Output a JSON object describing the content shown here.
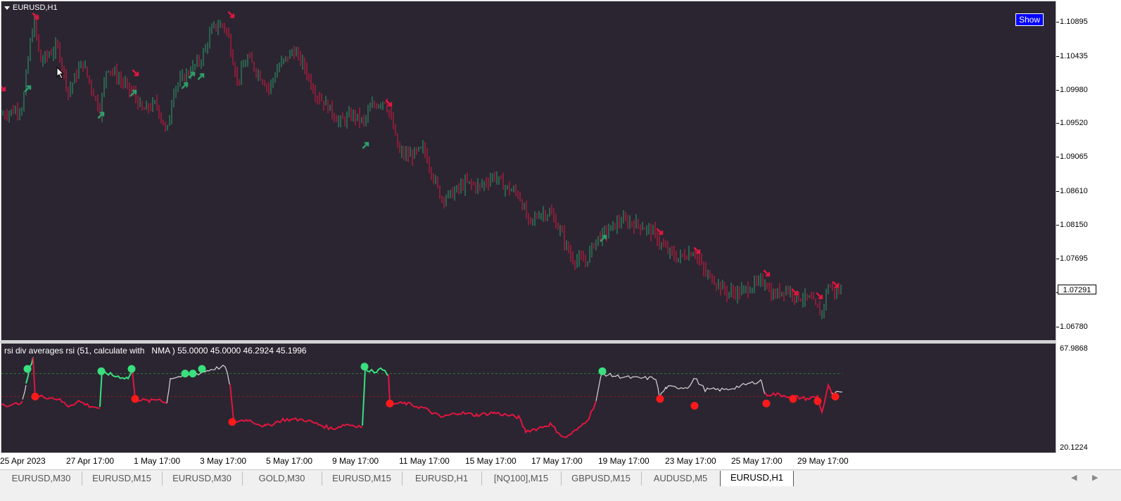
{
  "window": {
    "symbol": "EURUSD,H1",
    "show_button": "Show",
    "current_price": "1.07291"
  },
  "price_axis": [
    "1.10895",
    "1.10435",
    "1.09980",
    "1.09520",
    "1.09065",
    "1.08610",
    "1.08150",
    "1.07695",
    "1.07235",
    "1.06780"
  ],
  "indicator": {
    "title": "rsi div averages rsi (51, calculate with   NMA ) 55.0000 45.0000 46.2924 45.1996",
    "axis_max": "67.9868",
    "axis_min": "20.1224"
  },
  "time_axis": [
    "25 Apr 2023",
    "27 Apr 17:00",
    "1 May 17:00",
    "3 May 17:00",
    "5 May 17:00",
    "9 May 17:00",
    "11 May 17:00",
    "15 May 17:00",
    "17 May 17:00",
    "19 May 17:00",
    "23 May 17:00",
    "25 May 17:00",
    "29 May 17:00"
  ],
  "tabs": [
    {
      "label": "EURUSD,M30"
    },
    {
      "label": "EURUSD,M15"
    },
    {
      "label": "EURUSD,M30"
    },
    {
      "label": "GOLD,M30"
    },
    {
      "label": "EURUSD,M15"
    },
    {
      "label": "EURUSD,H1"
    },
    {
      "label": "[NQ100],M15"
    },
    {
      "label": "GBPUSD,M15"
    },
    {
      "label": "AUDUSD,M5"
    },
    {
      "label": "EURUSD,H1"
    }
  ],
  "active_tab": 9,
  "colors": {
    "background": "#2a2531",
    "bull": "#2e9e6a",
    "bear": "#e0163f",
    "rsi_green": "#39e07d",
    "rsi_red": "#e0163f",
    "rsi_white": "#d8d8d8",
    "show_button": "#0000ff"
  },
  "chart_data": {
    "type": "candlestick",
    "symbol": "EURUSD,H1",
    "ylim": [
      1.0665,
      1.1115
    ],
    "price_path": [
      [
        0,
        1.0965
      ],
      [
        30,
        1.0975
      ],
      [
        40,
        1.1055
      ],
      [
        47,
        1.109
      ],
      [
        55,
        1.1035
      ],
      [
        80,
        1.1055
      ],
      [
        95,
        1.0995
      ],
      [
        115,
        1.1035
      ],
      [
        140,
        1.097
      ],
      [
        150,
        1.103
      ],
      [
        175,
        1.1005
      ],
      [
        190,
        1.099
      ],
      [
        200,
        1.097
      ],
      [
        220,
        1.098
      ],
      [
        235,
        1.094
      ],
      [
        245,
        1.1
      ],
      [
        265,
        1.102
      ],
      [
        285,
        1.104
      ],
      [
        300,
        1.108
      ],
      [
        315,
        1.1085
      ],
      [
        322,
        1.107
      ],
      [
        335,
        1.101
      ],
      [
        350,
        1.104
      ],
      [
        365,
        1.102
      ],
      [
        380,
        1.1
      ],
      [
        395,
        1.103
      ],
      [
        415,
        1.105
      ],
      [
        430,
        1.103
      ],
      [
        445,
        1.0995
      ],
      [
        465,
        1.0975
      ],
      [
        480,
        1.0955
      ],
      [
        500,
        1.0965
      ],
      [
        515,
        1.0955
      ],
      [
        525,
        1.0975
      ],
      [
        545,
        1.0985
      ],
      [
        555,
        1.0955
      ],
      [
        565,
        1.0915
      ],
      [
        580,
        1.091
      ],
      [
        600,
        1.092
      ],
      [
        615,
        1.088
      ],
      [
        625,
        1.0855
      ],
      [
        640,
        1.086
      ],
      [
        660,
        1.0875
      ],
      [
        680,
        1.087
      ],
      [
        700,
        1.0885
      ],
      [
        715,
        1.087
      ],
      [
        735,
        1.086
      ],
      [
        750,
        1.082
      ],
      [
        765,
        1.0835
      ],
      [
        780,
        1.0835
      ],
      [
        795,
        1.081
      ],
      [
        810,
        1.0775
      ],
      [
        830,
        1.077
      ],
      [
        845,
        1.08
      ],
      [
        860,
        1.081
      ],
      [
        880,
        1.0825
      ],
      [
        905,
        1.082
      ],
      [
        925,
        1.081
      ],
      [
        940,
        1.079
      ],
      [
        960,
        1.0775
      ],
      [
        985,
        1.0785
      ],
      [
        1000,
        1.0755
      ],
      [
        1015,
        1.0745
      ],
      [
        1030,
        1.073
      ],
      [
        1050,
        1.073
      ],
      [
        1070,
        1.074
      ],
      [
        1085,
        1.0745
      ],
      [
        1095,
        1.0725
      ],
      [
        1115,
        1.0735
      ],
      [
        1130,
        1.0725
      ],
      [
        1150,
        1.072
      ],
      [
        1165,
        1.07
      ],
      [
        1175,
        1.074
      ],
      [
        1185,
        1.073
      ],
      [
        1195,
        1.0735
      ]
    ],
    "signals": [
      {
        "x": 2,
        "price": 1.1,
        "dir": "down"
      },
      {
        "x": 49,
        "price": 1.1095,
        "dir": "down"
      },
      {
        "x": 38,
        "price": 1.1,
        "dir": "up"
      },
      {
        "x": 142,
        "price": 1.0965,
        "dir": "up"
      },
      {
        "x": 188,
        "price": 1.0994,
        "dir": "up"
      },
      {
        "x": 191,
        "price": 1.102,
        "dir": "down"
      },
      {
        "x": 261,
        "price": 1.1004,
        "dir": "up"
      },
      {
        "x": 271,
        "price": 1.1018,
        "dir": "up"
      },
      {
        "x": 284,
        "price": 1.1016,
        "dir": "up"
      },
      {
        "x": 327,
        "price": 1.1097,
        "dir": "down"
      },
      {
        "x": 518,
        "price": 1.0925,
        "dir": "up"
      },
      {
        "x": 551,
        "price": 1.098,
        "dir": "down"
      },
      {
        "x": 856,
        "price": 1.0802,
        "dir": "up"
      },
      {
        "x": 936,
        "price": 1.081,
        "dir": "down"
      },
      {
        "x": 989,
        "price": 1.0785,
        "dir": "down"
      },
      {
        "x": 1088,
        "price": 1.0755,
        "dir": "down"
      },
      {
        "x": 1128,
        "price": 1.073,
        "dir": "down"
      },
      {
        "x": 1163,
        "price": 1.0725,
        "dir": "down"
      },
      {
        "x": 1186,
        "price": 1.074,
        "dir": "down"
      }
    ],
    "rsi": {
      "ylim": [
        20.1224,
        67.9868
      ],
      "levels": [
        55,
        45
      ],
      "segments": [
        {
          "color": "red",
          "points": [
            [
              0,
              42
            ],
            [
              15,
              41
            ],
            [
              30,
              43
            ]
          ]
        },
        {
          "color": "white",
          "points": [
            [
              30,
              43
            ],
            [
              35,
              50
            ]
          ]
        },
        {
          "color": "green",
          "points": [
            [
              35,
              50
            ],
            [
              40,
              57
            ],
            [
              45,
              62
            ]
          ]
        },
        {
          "color": "red",
          "points": [
            [
              45,
              62
            ],
            [
              48,
              45
            ],
            [
              60,
              45
            ],
            [
              80,
              44
            ],
            [
              95,
              41
            ],
            [
              110,
              43
            ],
            [
              125,
              41
            ],
            [
              140,
              40
            ]
          ]
        },
        {
          "color": "green",
          "points": [
            [
              140,
              40
            ],
            [
              143,
              56
            ],
            [
              160,
              54
            ],
            [
              180,
              53
            ],
            [
              186,
              56
            ]
          ]
        },
        {
          "color": "red",
          "points": [
            [
              186,
              56
            ],
            [
              190,
              44
            ],
            [
              210,
              43
            ],
            [
              225,
              44
            ],
            [
              235,
              42
            ]
          ]
        },
        {
          "color": "white",
          "points": [
            [
              235,
              42
            ],
            [
              240,
              53
            ],
            [
              260,
              54
            ],
            [
              280,
              55
            ],
            [
              300,
              57
            ],
            [
              318,
              58
            ],
            [
              325,
              50
            ]
          ]
        },
        {
          "color": "red",
          "points": [
            [
              325,
              50
            ],
            [
              330,
              34
            ],
            [
              350,
              35
            ],
            [
              375,
              32
            ],
            [
              400,
              35
            ],
            [
              430,
              35
            ],
            [
              450,
              33
            ],
            [
              470,
              31
            ],
            [
              490,
              33
            ],
            [
              513,
              32
            ]
          ]
        },
        {
          "color": "green",
          "points": [
            [
              513,
              32
            ],
            [
              517,
              57
            ],
            [
              530,
              56
            ],
            [
              545,
              57
            ],
            [
              550,
              54
            ]
          ]
        },
        {
          "color": "red",
          "points": [
            [
              550,
              54
            ],
            [
              552,
              42
            ],
            [
              575,
              42
            ],
            [
              600,
              40
            ],
            [
              625,
              36
            ],
            [
              650,
              38
            ],
            [
              675,
              37
            ],
            [
              700,
              38
            ],
            [
              735,
              36
            ],
            [
              745,
              30
            ],
            [
              760,
              31
            ],
            [
              780,
              33
            ],
            [
              800,
              27
            ],
            [
              820,
              31
            ],
            [
              835,
              36
            ],
            [
              845,
              43
            ]
          ]
        },
        {
          "color": "white",
          "points": [
            [
              845,
              43
            ],
            [
              853,
              55
            ],
            [
              870,
              54
            ],
            [
              900,
              53
            ],
            [
              930,
              53
            ],
            [
              935,
              45
            ],
            [
              945,
              49
            ],
            [
              975,
              49
            ],
            [
              985,
              53
            ],
            [
              1000,
              48
            ],
            [
              1030,
              48
            ],
            [
              1055,
              50
            ],
            [
              1080,
              52
            ],
            [
              1085,
              46
            ]
          ]
        },
        {
          "color": "red",
          "points": [
            [
              1085,
              46
            ],
            [
              1100,
              46
            ],
            [
              1125,
              45
            ],
            [
              1145,
              44
            ],
            [
              1160,
              45
            ],
            [
              1166,
              38
            ],
            [
              1175,
              50
            ],
            [
              1180,
              46
            ]
          ]
        },
        {
          "color": "white",
          "points": [
            [
              1180,
              46
            ],
            [
              1195,
              47
            ]
          ]
        }
      ],
      "dots": [
        {
          "x": 37,
          "value": 57,
          "color": "green"
        },
        {
          "x": 48,
          "value": 45,
          "color": "red"
        },
        {
          "x": 142,
          "value": 56,
          "color": "green"
        },
        {
          "x": 185,
          "value": 57,
          "color": "green"
        },
        {
          "x": 190,
          "value": 44,
          "color": "red"
        },
        {
          "x": 261,
          "value": 55,
          "color": "green"
        },
        {
          "x": 272,
          "value": 55,
          "color": "green"
        },
        {
          "x": 285,
          "value": 57,
          "color": "green"
        },
        {
          "x": 328,
          "value": 34,
          "color": "red"
        },
        {
          "x": 516,
          "value": 58,
          "color": "green"
        },
        {
          "x": 552,
          "value": 42,
          "color": "red"
        },
        {
          "x": 854,
          "value": 56,
          "color": "green"
        },
        {
          "x": 936,
          "value": 44,
          "color": "red"
        },
        {
          "x": 985,
          "value": 41,
          "color": "red"
        },
        {
          "x": 1087,
          "value": 42,
          "color": "red"
        },
        {
          "x": 1125,
          "value": 44,
          "color": "red"
        },
        {
          "x": 1160,
          "value": 43,
          "color": "red"
        },
        {
          "x": 1185,
          "value": 45,
          "color": "red"
        }
      ]
    }
  }
}
